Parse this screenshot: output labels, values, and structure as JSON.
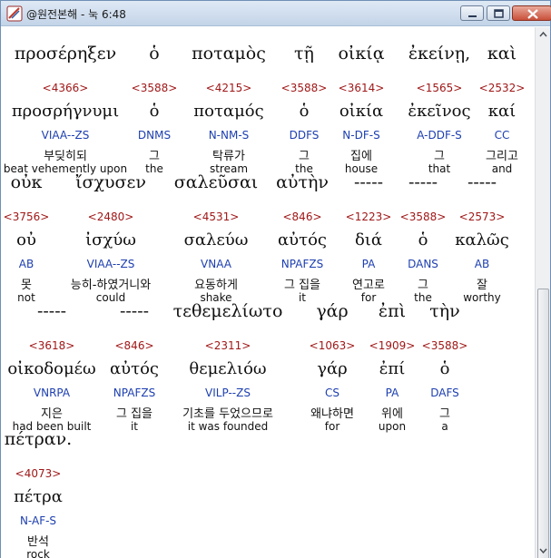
{
  "window": {
    "title": "@원전본해 - 눅 6:48"
  },
  "blocks": [
    {
      "greek": "προσέρηξεν",
      "strong": "<4366>",
      "lemma": "προσρήγνυμι",
      "morph": "VIAA--ZS",
      "korean": "부딪히되",
      "english": "beat vehemently upon"
    },
    {
      "greek": "ὁ",
      "strong": "<3588>",
      "lemma": "ὁ",
      "morph": "DNMS",
      "korean": "그",
      "english": "the"
    },
    {
      "greek": "ποταμὸς",
      "strong": "<4215>",
      "lemma": "ποταμός",
      "morph": "N-NM-S",
      "korean": "탁류가",
      "english": "stream"
    },
    {
      "greek": "τῇ",
      "strong": "<3588>",
      "lemma": "ὁ",
      "morph": "DDFS",
      "korean": "그",
      "english": "the"
    },
    {
      "greek": "οἰκίᾳ",
      "strong": "<3614>",
      "lemma": "οἰκία",
      "morph": "N-DF-S",
      "korean": "집에",
      "english": "house"
    },
    {
      "greek": "ἐκείνῃ,",
      "strong": "<1565>",
      "lemma": "ἐκεῖνος",
      "morph": "A-DDF-S",
      "korean": "그",
      "english": "that"
    },
    {
      "greek": "καὶ",
      "strong": "<2532>",
      "lemma": "καί",
      "morph": "CC",
      "korean": "그리고",
      "english": "and"
    },
    {
      "greek": "οὐκ",
      "strong": "<3756>",
      "lemma": "οὐ",
      "morph": "AB",
      "korean": "못",
      "english": "not"
    },
    {
      "greek": "ἴσχυσεν",
      "strong": "<2480>",
      "lemma": "ἰσχύω",
      "morph": "VIAA--ZS",
      "korean": "능히-하였거니와",
      "english": "could"
    },
    {
      "greek": "σαλεῦσαι",
      "strong": "<4531>",
      "lemma": "σαλεύω",
      "morph": "VNAA",
      "korean": "요동하게",
      "english": "shake"
    },
    {
      "greek": "αὐτὴν",
      "strong": "<846>",
      "lemma": "αὐτός",
      "morph": "NPAFZS",
      "korean": "그 집을",
      "english": "it"
    },
    {
      "greek": "-----",
      "strong": "<1223>",
      "lemma": "διά",
      "morph": "PA",
      "korean": "연고로",
      "english": "for"
    },
    {
      "greek": "-----",
      "strong": "<3588>",
      "lemma": "ὁ",
      "morph": "DANS",
      "korean": "그",
      "english": "the"
    },
    {
      "greek": "-----",
      "strong": "<2573>",
      "lemma": "καλῶς",
      "morph": "AB",
      "korean": "잘",
      "english": "worthy"
    },
    {
      "greek": "-----",
      "strong": "<3618>",
      "lemma": "οἰκοδομέω",
      "morph": "VNRPA",
      "korean": "지은",
      "english": "had been built"
    },
    {
      "greek": "-----",
      "strong": "<846>",
      "lemma": "αὐτός",
      "morph": "NPAFZS",
      "korean": "그 집을",
      "english": "it"
    },
    {
      "greek": "τεθεμελίωτο",
      "strong": "<2311>",
      "lemma": "θεμελιόω",
      "morph": "VILP--ZS",
      "korean": "기초를 두었으므로",
      "english": "it was founded"
    },
    {
      "greek": "γάρ",
      "strong": "<1063>",
      "lemma": "γάρ",
      "morph": "CS",
      "korean": "왜냐하면",
      "english": "for"
    },
    {
      "greek": "ἐπὶ",
      "strong": "<1909>",
      "lemma": "ἐπί",
      "morph": "PA",
      "korean": "위에",
      "english": "upon"
    },
    {
      "greek": "τὴν",
      "strong": "<3588>",
      "lemma": "ὁ",
      "morph": "DAFS",
      "korean": "그",
      "english": "a"
    },
    {
      "greek": "πέτραν.",
      "strong": "<4073>",
      "lemma": "πέτρα",
      "morph": "N-AF-S",
      "korean": "반석",
      "english": "rock"
    }
  ],
  "colors": {
    "strong": "#a01818",
    "morph": "#1d3fb0"
  }
}
